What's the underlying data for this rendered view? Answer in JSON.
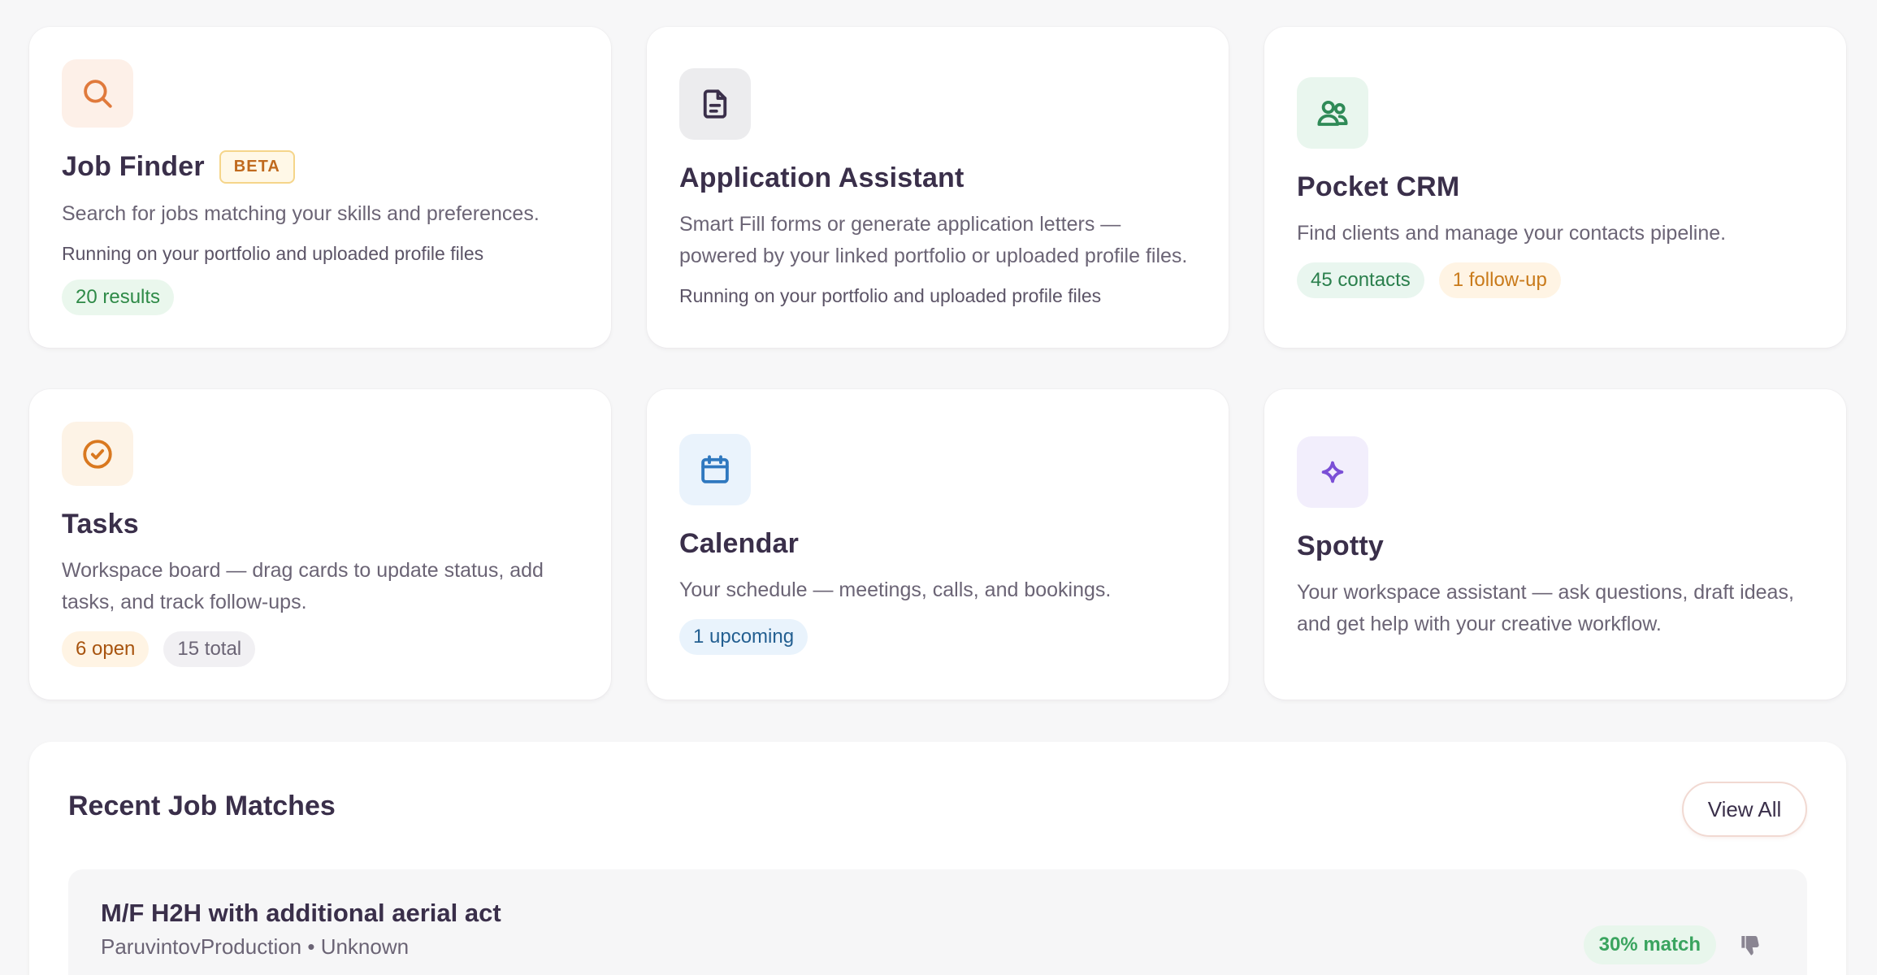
{
  "cards": [
    {
      "title": "Job Finder",
      "badge": "BETA",
      "icon": "search-icon",
      "description": "Search for jobs matching your skills and preferences.",
      "note": "Running on your portfolio and uploaded profile files",
      "chips": [
        "20 results"
      ]
    },
    {
      "title": "Application Assistant",
      "icon": "document-icon",
      "description": "Smart Fill forms or generate application letters — powered by your linked portfolio or uploaded profile files.",
      "note": "Running on your portfolio and uploaded profile files"
    },
    {
      "title": "Pocket CRM",
      "icon": "users-icon",
      "description": "Find clients and manage your contacts pipeline.",
      "chips": [
        "45 contacts",
        "1 follow-up"
      ]
    },
    {
      "title": "Tasks",
      "icon": "check-circle-icon",
      "description": "Workspace board — drag cards to update status, add tasks, and track follow-ups.",
      "chips": [
        "6 open",
        "15 total"
      ]
    },
    {
      "title": "Calendar",
      "icon": "calendar-icon",
      "description": "Your schedule — meetings, calls, and bookings.",
      "chips": [
        "1 upcoming"
      ]
    },
    {
      "title": "Spotty",
      "icon": "sparkle-icon",
      "description": "Your workspace assistant — ask questions, draft ideas, and get help with your creative workflow."
    }
  ],
  "recent": {
    "title": "Recent Job Matches",
    "view_all": "View All",
    "jobs": [
      {
        "title": "M/F H2H with additional aerial act",
        "meta": "ParuvintovProduction • Unknown",
        "match": "30% match",
        "icon": "thumbs-down-icon"
      }
    ]
  },
  "colors": {
    "background": "#f7f7f8",
    "search_icon": "#e07a3c",
    "document_icon": "#3a2f4a",
    "users_icon": "#2f8a57",
    "check_icon": "#d9781f",
    "calendar_icon": "#2f78bf",
    "sparkle_icon": "#7b4fd6"
  }
}
